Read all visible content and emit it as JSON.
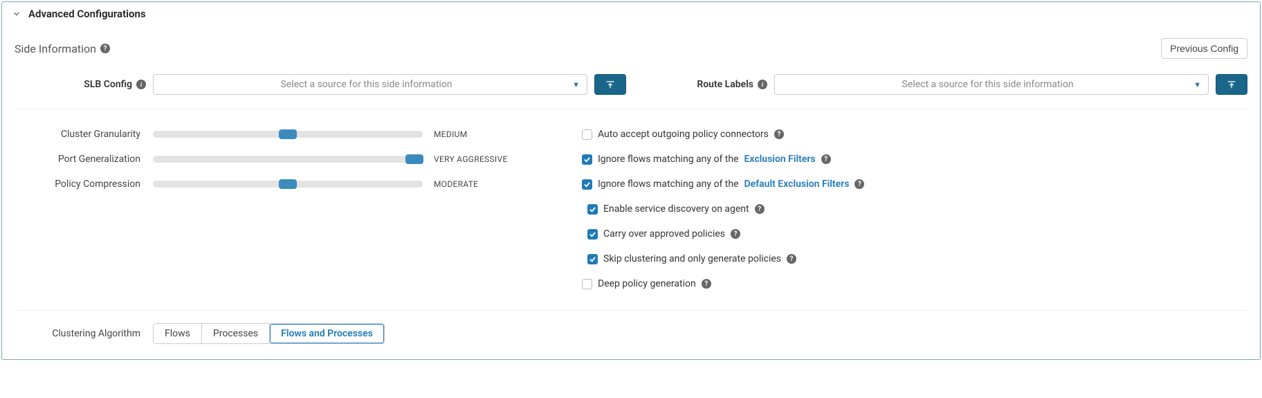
{
  "header": {
    "title": "Advanced Configurations"
  },
  "sideInfo": {
    "label": "Side Information",
    "previousConfigLabel": "Previous Config"
  },
  "slbConfig": {
    "label": "SLB Config",
    "placeholder": "Select a source for this side information"
  },
  "routeLabels": {
    "label": "Route Labels",
    "placeholder": "Select a source for this side information"
  },
  "sliders": {
    "clusterGranularity": {
      "label": "Cluster Granularity",
      "valueLabel": "Medium",
      "percent": 50
    },
    "portGeneralization": {
      "label": "Port Generalization",
      "valueLabel": "Very Aggressive",
      "percent": 97
    },
    "policyCompression": {
      "label": "Policy Compression",
      "valueLabel": "Moderate",
      "percent": 50
    }
  },
  "checkboxes": {
    "autoAccept": {
      "checked": false,
      "label": "Auto accept outgoing policy connectors"
    },
    "ignoreExcl": {
      "checked": true,
      "prefix": "Ignore flows matching any of the",
      "link": "Exclusion Filters"
    },
    "ignoreDefExcl": {
      "checked": true,
      "prefix": "Ignore flows matching any of the",
      "link": "Default Exclusion Filters"
    },
    "enableSvc": {
      "checked": true,
      "label": "Enable service discovery on agent"
    },
    "carryOver": {
      "checked": true,
      "label": "Carry over approved policies"
    },
    "skipCluster": {
      "checked": true,
      "label": "Skip clustering and only generate policies"
    },
    "deepPolicy": {
      "checked": false,
      "label": "Deep policy generation"
    }
  },
  "clusteringAlgorithm": {
    "label": "Clustering Algorithm",
    "options": {
      "flows": "Flows",
      "processes": "Processes",
      "both": "Flows and Processes"
    },
    "selected": "both"
  }
}
